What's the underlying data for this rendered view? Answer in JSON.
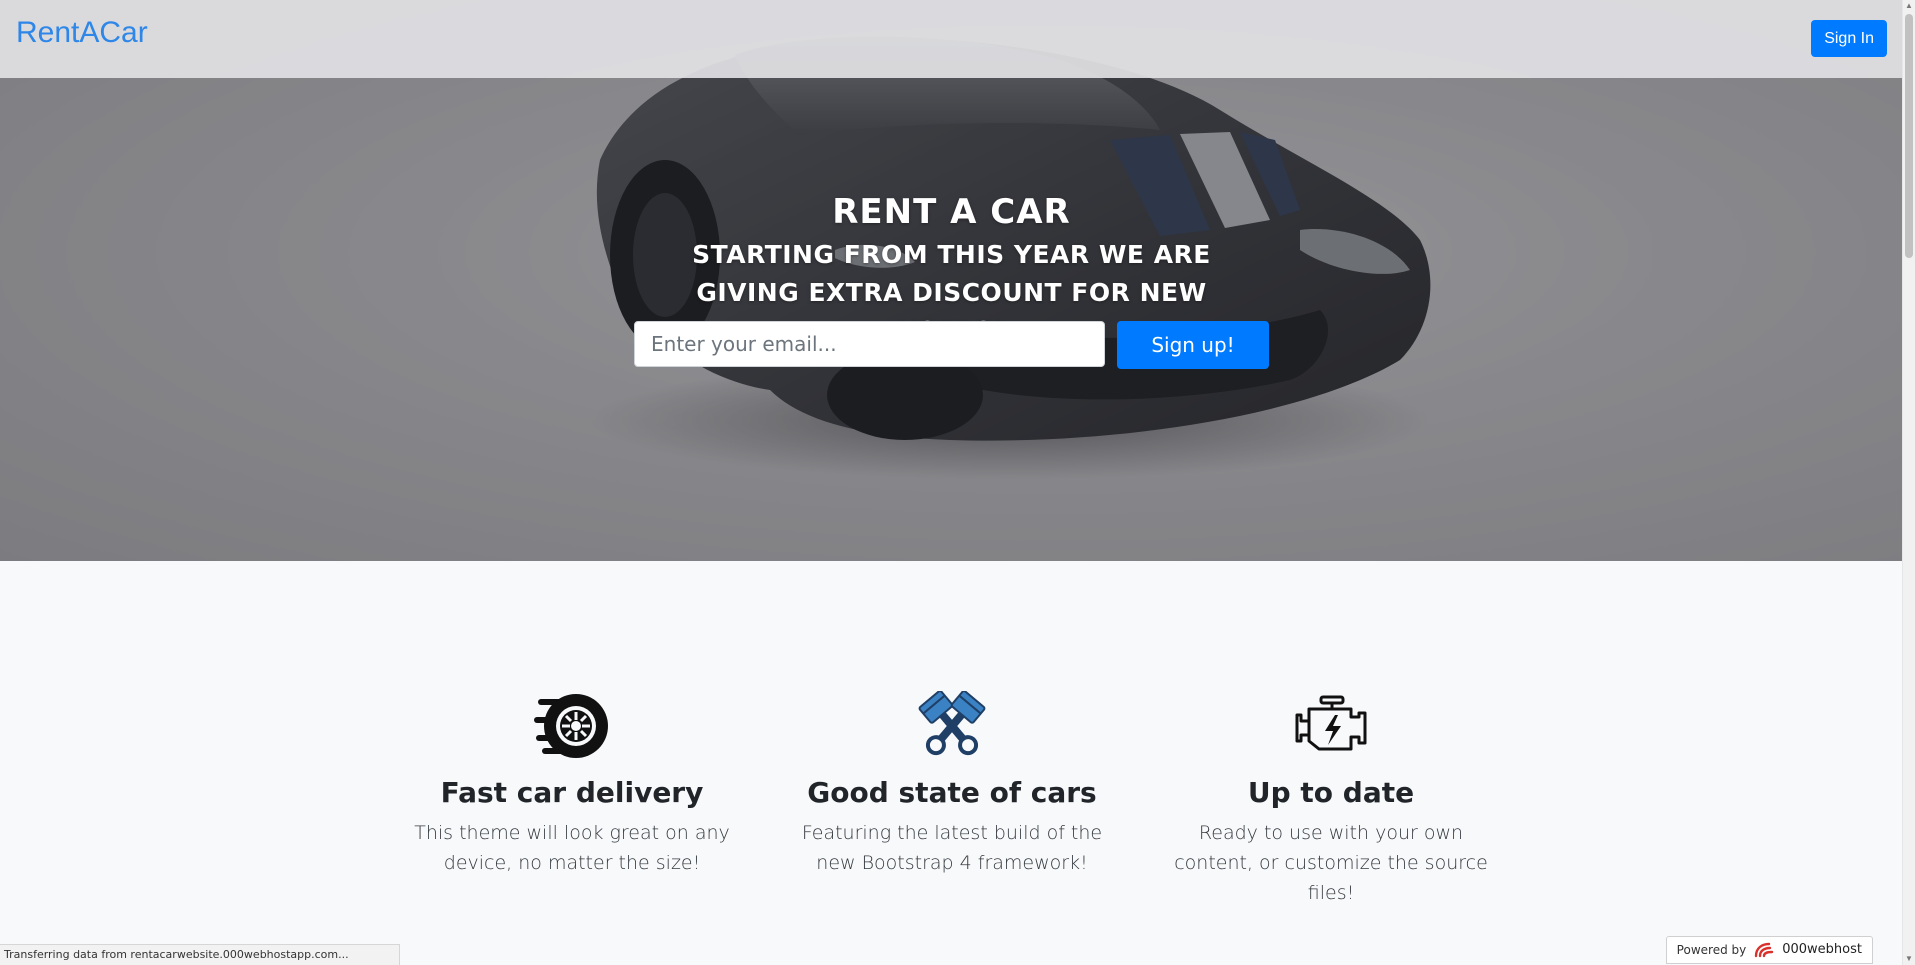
{
  "navbar": {
    "brand": "RentACar",
    "signin_label": "Sign In"
  },
  "hero": {
    "title": "RENT A CAR",
    "subtitle": "STARTING FROM THIS YEAR WE ARE GIVING EXTRA DISCOUNT FOR NEW USERS!",
    "email_placeholder": "Enter your email...",
    "signup_label": "Sign up!"
  },
  "features": [
    {
      "icon": "tire-icon",
      "title": "Fast car delivery",
      "text": "This theme will look great on any device, no matter the size!"
    },
    {
      "icon": "crossed-pistons-icon",
      "title": "Good state of cars",
      "text": "Featuring the latest build of the new Bootstrap 4 framework!"
    },
    {
      "icon": "engine-icon",
      "title": "Up to date",
      "text": "Ready to use with your own content, or customize the source files!"
    }
  ],
  "status_bar": {
    "text": "Transferring data from rentacarwebsite.000webhostapp.com..."
  },
  "powered_by": {
    "label": "Powered by",
    "host": "000webhost"
  },
  "colors": {
    "brand": "#2d86e8",
    "primary_button": "#007bff",
    "section_background": "#f8f9fa",
    "piston_icon": "#3b82c4"
  }
}
